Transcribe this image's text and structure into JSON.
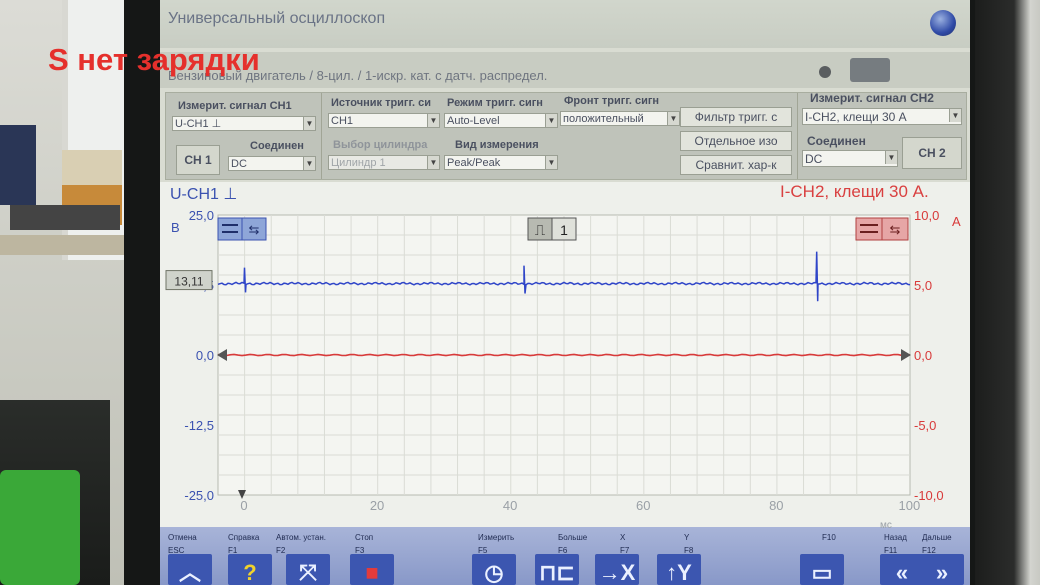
{
  "overlay_caption": "S нет зарядки",
  "app": {
    "title": "Универсальный осциллоскоп",
    "subtitle": "Бензиновый двигатель / 8-цил. / 1-искр. кат. с датч. распредел."
  },
  "panel": {
    "ch1_signal_label": "Измерит. сигнал CH1",
    "ch1_signal_value": "U-CH1 ⊥",
    "ch1_button": "CH 1",
    "ch1_coupling_label": "Соединен",
    "ch1_coupling_value": "DC",
    "trigger_source_label": "Источник тригг. си",
    "trigger_source_value": "CH1",
    "trigger_mode_label": "Режим тригг. сигн",
    "trigger_mode_value": "Auto-Level",
    "trigger_edge_label": "Фронт тригг. сигн",
    "trigger_edge_value": "положительный",
    "cylinder_label": "Выбор цилиндра",
    "cylinder_value": "Цилиндр 1",
    "measure_type_label": "Вид измерения",
    "measure_type_value": "Peak/Peak",
    "filter_button": "Фильтр тригг. с",
    "separate_button": "Отдельное изо",
    "compare_button": "Сравнит. хар-к",
    "ch2_signal_label": "Измерит. сигнал CH2",
    "ch2_signal_value": "I-CH2, клещи 30 A",
    "ch2_coupling_label": "Соединен",
    "ch2_coupling_value": "DC",
    "ch2_button": "CH 2"
  },
  "chart_data": {
    "type": "line",
    "ch1_label": "U-CH1 ⊥",
    "ch2_label": "I-CH2, клещи 30 A.",
    "left_unit": "В",
    "right_unit": "A",
    "x_unit": "мс",
    "left_ticks": [
      "25,0",
      "12,5",
      "0,0",
      "-12,5",
      "-25,0"
    ],
    "right_ticks": [
      "10,0",
      "5,0",
      "0,0",
      "-5,0",
      "-10,0"
    ],
    "x_ticks": [
      "0",
      "20",
      "40",
      "60",
      "80",
      "100"
    ],
    "xlim": [
      0,
      104
    ],
    "ylim_left": [
      -25,
      25
    ],
    "ylim_right": [
      -10,
      10
    ],
    "ch1_level_readout": "13,11",
    "ch1_level": 13.11,
    "ch1_spike_x": [
      0,
      42,
      86
    ],
    "ch2_level": 0.0,
    "trigger_channel": "1",
    "series": [
      {
        "name": "U-CH1",
        "color": "#2f45c8"
      },
      {
        "name": "I-CH2",
        "color": "#d83a3a"
      }
    ]
  },
  "funcbar": {
    "labels": [
      {
        "text": "Отмена",
        "key": "ESC"
      },
      {
        "text": "Справка",
        "key": "F1"
      },
      {
        "text": "Автом. устан.",
        "key": "F2"
      },
      {
        "text": "Стоп",
        "key": "F3"
      },
      {
        "text": "Измерить",
        "key": "F5"
      },
      {
        "text": "Больше",
        "key": "F6"
      },
      {
        "text": "X",
        "key": "F7"
      },
      {
        "text": "Y",
        "key": "F8"
      },
      {
        "text": "F10",
        "key": ""
      },
      {
        "text": "Назад",
        "key": "F11"
      },
      {
        "text": "Дальше",
        "key": "F12"
      }
    ]
  }
}
